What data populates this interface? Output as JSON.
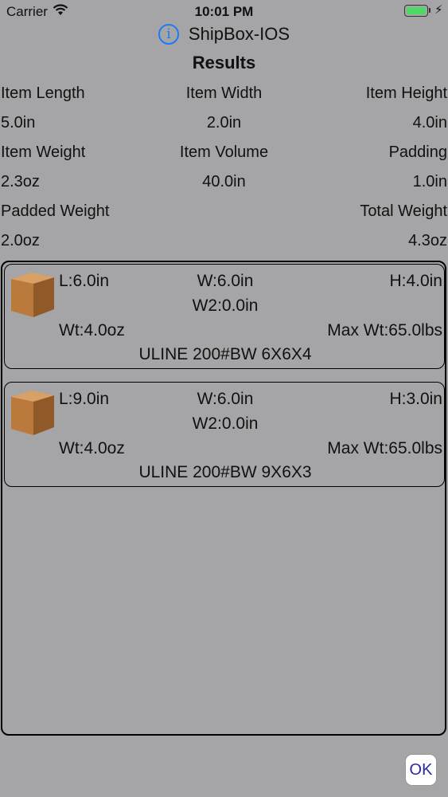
{
  "status_bar": {
    "carrier": "Carrier",
    "time": "10:01 PM",
    "battery_level": 1.0,
    "charging_symbol": "⚡"
  },
  "header": {
    "title": "ShipBox-IOS",
    "info_icon_glyph": "i"
  },
  "results": {
    "title": "Results",
    "rows": [
      [
        "Item Length",
        "Item Width",
        "Item Height"
      ],
      [
        "5.0in",
        "2.0in",
        "4.0in"
      ],
      [
        "Item Weight",
        "Item Volume",
        "Padding"
      ],
      [
        "2.3oz",
        "40.0in",
        "1.0in"
      ],
      [
        "Padded Weight",
        "",
        "Total Weight"
      ],
      [
        "2.0oz",
        "",
        "4.3oz"
      ]
    ]
  },
  "boxes": [
    {
      "length": "L:6.0in",
      "width": "W:6.0in",
      "height": "H:4.0in",
      "w2": "W2:0.0in",
      "weight": "Wt:4.0oz",
      "max_weight": "Max Wt:65.0lbs",
      "name": "ULINE 200#BW 6X6X4"
    },
    {
      "length": "L:9.0in",
      "width": "W:6.0in",
      "height": "H:3.0in",
      "w2": "W2:0.0in",
      "weight": "Wt:4.0oz",
      "max_weight": "Max Wt:65.0lbs",
      "name": "ULINE 200#BW 9X6X3"
    }
  ],
  "ok_button": {
    "label": "OK"
  },
  "colors": {
    "background": "#a5a4a6",
    "accent": "#1a7cf5",
    "box_brown": "#b97a3c",
    "ok_text": "#2a2a9a"
  }
}
